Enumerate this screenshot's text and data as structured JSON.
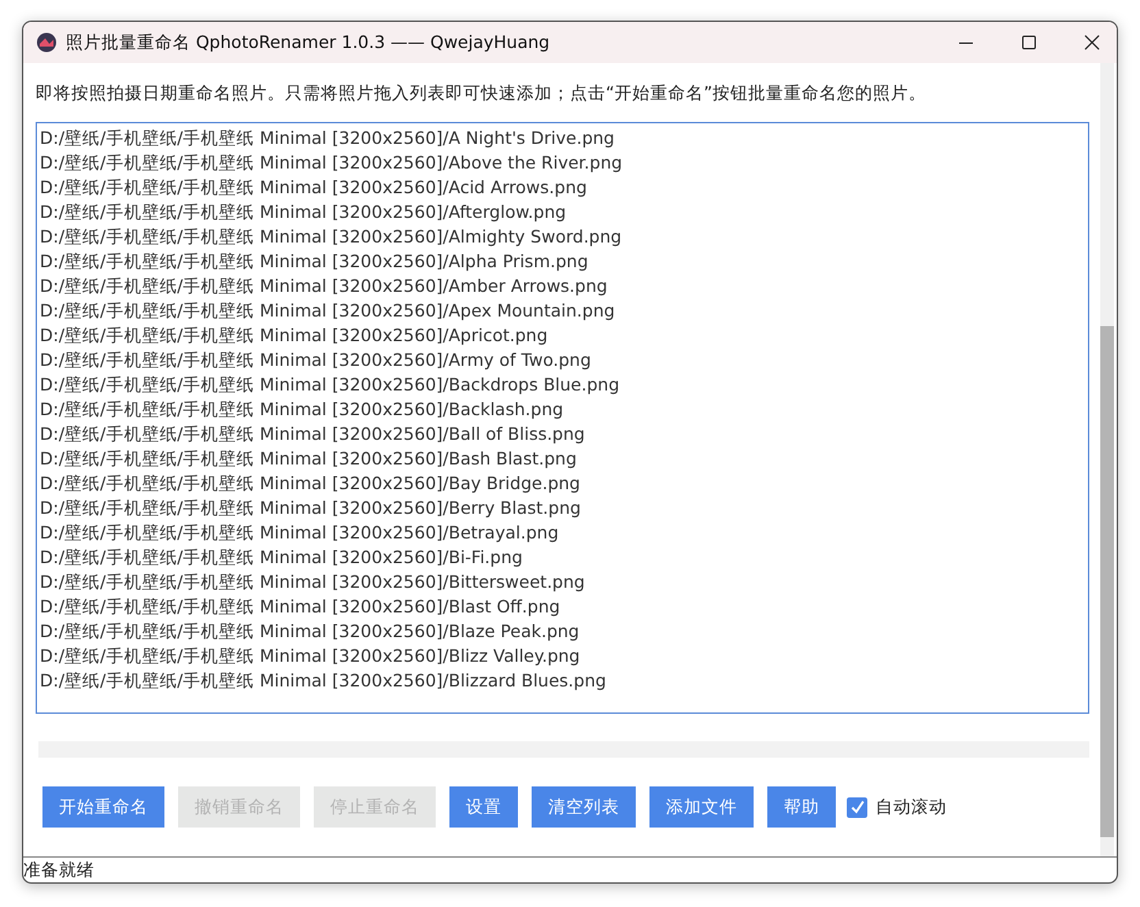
{
  "window": {
    "title": "照片批量重命名 QphotoRenamer 1.0.3 —— QwejayHuang"
  },
  "instructions": "即将按照拍摄日期重命名照片。只需将照片拖入列表即可快速添加；点击“开始重命名”按钮批量重命名您的照片。",
  "files": [
    "D:/壁纸/手机壁纸/手机壁纸 Minimal [3200x2560]/A Night's Drive.png",
    "D:/壁纸/手机壁纸/手机壁纸 Minimal [3200x2560]/Above the River.png",
    "D:/壁纸/手机壁纸/手机壁纸 Minimal [3200x2560]/Acid Arrows.png",
    "D:/壁纸/手机壁纸/手机壁纸 Minimal [3200x2560]/Afterglow.png",
    "D:/壁纸/手机壁纸/手机壁纸 Minimal [3200x2560]/Almighty Sword.png",
    "D:/壁纸/手机壁纸/手机壁纸 Minimal [3200x2560]/Alpha Prism.png",
    "D:/壁纸/手机壁纸/手机壁纸 Minimal [3200x2560]/Amber Arrows.png",
    "D:/壁纸/手机壁纸/手机壁纸 Minimal [3200x2560]/Apex Mountain.png",
    "D:/壁纸/手机壁纸/手机壁纸 Minimal [3200x2560]/Apricot.png",
    "D:/壁纸/手机壁纸/手机壁纸 Minimal [3200x2560]/Army of Two.png",
    "D:/壁纸/手机壁纸/手机壁纸 Minimal [3200x2560]/Backdrops Blue.png",
    "D:/壁纸/手机壁纸/手机壁纸 Minimal [3200x2560]/Backlash.png",
    "D:/壁纸/手机壁纸/手机壁纸 Minimal [3200x2560]/Ball of Bliss.png",
    "D:/壁纸/手机壁纸/手机壁纸 Minimal [3200x2560]/Bash Blast.png",
    "D:/壁纸/手机壁纸/手机壁纸 Minimal [3200x2560]/Bay Bridge.png",
    "D:/壁纸/手机壁纸/手机壁纸 Minimal [3200x2560]/Berry Blast.png",
    "D:/壁纸/手机壁纸/手机壁纸 Minimal [3200x2560]/Betrayal.png",
    "D:/壁纸/手机壁纸/手机壁纸 Minimal [3200x2560]/Bi-Fi.png",
    "D:/壁纸/手机壁纸/手机壁纸 Minimal [3200x2560]/Bittersweet.png",
    "D:/壁纸/手机壁纸/手机壁纸 Minimal [3200x2560]/Blast Off.png",
    "D:/壁纸/手机壁纸/手机壁纸 Minimal [3200x2560]/Blaze Peak.png",
    "D:/壁纸/手机壁纸/手机壁纸 Minimal [3200x2560]/Blizz Valley.png",
    "D:/壁纸/手机壁纸/手机壁纸 Minimal [3200x2560]/Blizzard Blues.png"
  ],
  "progress": {
    "level": 0
  },
  "buttons": [
    {
      "label": "开始重命名",
      "disabled": false
    },
    {
      "label": "撤销重命名",
      "disabled": true
    },
    {
      "label": "停止重命名",
      "disabled": true
    },
    {
      "label": "设置",
      "disabled": false
    },
    {
      "label": "清空列表",
      "disabled": false
    },
    {
      "label": "添加文件",
      "disabled": false
    },
    {
      "label": "帮助",
      "disabled": false
    }
  ],
  "auto_scroll": {
    "label": "自动滚动",
    "checked": true
  },
  "status_bar": "准备就绪"
}
